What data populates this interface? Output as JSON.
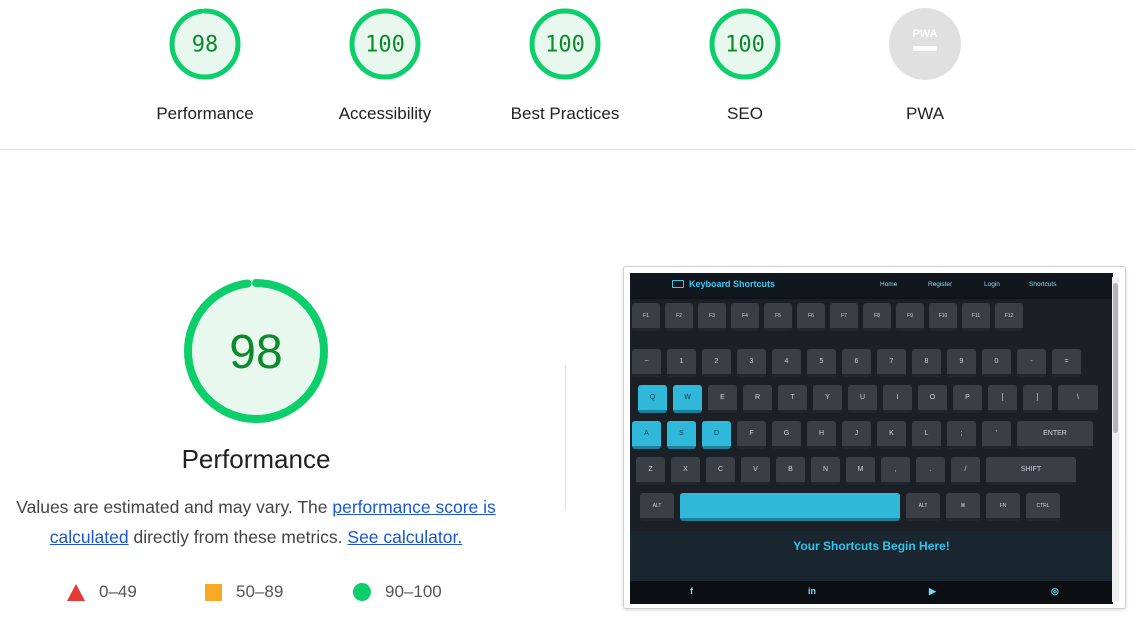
{
  "categories": [
    {
      "label": "Performance",
      "score": "98",
      "value": 98,
      "color": "#0cce6b"
    },
    {
      "label": "Accessibility",
      "score": "100",
      "value": 100,
      "color": "#0cce6b"
    },
    {
      "label": "Best Practices",
      "score": "100",
      "value": 100,
      "color": "#0cce6b"
    },
    {
      "label": "SEO",
      "score": "100",
      "value": 100,
      "color": "#0cce6b"
    },
    {
      "label": "PWA",
      "score": "",
      "value": null,
      "color": "#cccccc",
      "badge_text": "PWA"
    }
  ],
  "main": {
    "score": "98",
    "value": 98,
    "title": "Performance",
    "desc_before": "Values are estimated and may vary. The ",
    "link_perf": "performance score is calculated",
    "desc_middle": " directly from these metrics. ",
    "link_calc": "See calculator."
  },
  "legend": [
    {
      "range": "0–49",
      "color": "#e53935",
      "shape": "triangle"
    },
    {
      "range": "50–89",
      "color": "#f9a825",
      "shape": "square"
    },
    {
      "range": "90–100",
      "color": "#0cce6b",
      "shape": "circle"
    }
  ],
  "screenshot": {
    "brand": "Keyboard Shortcuts",
    "nav_links": [
      "Home",
      "Register",
      "Login",
      "Shortcuts"
    ],
    "hero_text": "Your Shortcuts Begin Here!",
    "social_icons": [
      "f",
      "in",
      "▶",
      "◎"
    ],
    "social_names": [
      "facebook-icon",
      "linkedin-icon",
      "youtube-icon",
      "instagram-icon"
    ],
    "keys": {
      "fn_row": [
        "F1",
        "F2",
        "F3",
        "F4",
        "F5",
        "F6",
        "F7",
        "F8",
        "F9",
        "F10",
        "F11",
        "F12"
      ],
      "num_row": [
        "~",
        "1",
        "2",
        "3",
        "4",
        "5",
        "6",
        "7",
        "8",
        "9",
        "0",
        "-",
        "=",
        "⌫"
      ],
      "q_row": [
        "Q",
        "W",
        "E",
        "R",
        "T",
        "Y",
        "U",
        "I",
        "O",
        "P",
        "[",
        "]",
        "\\"
      ],
      "a_row": [
        "A",
        "S",
        "D",
        "F",
        "G",
        "H",
        "J",
        "K",
        "L",
        ";",
        "'",
        "ENTER"
      ],
      "z_row": [
        "Z",
        "X",
        "C",
        "V",
        "B",
        "N",
        "M",
        ",",
        ".",
        "/",
        "SHIFT"
      ],
      "bottom_row": [
        "ALT",
        "",
        "ALT",
        "⌘",
        "FN",
        "CTRL"
      ]
    }
  }
}
